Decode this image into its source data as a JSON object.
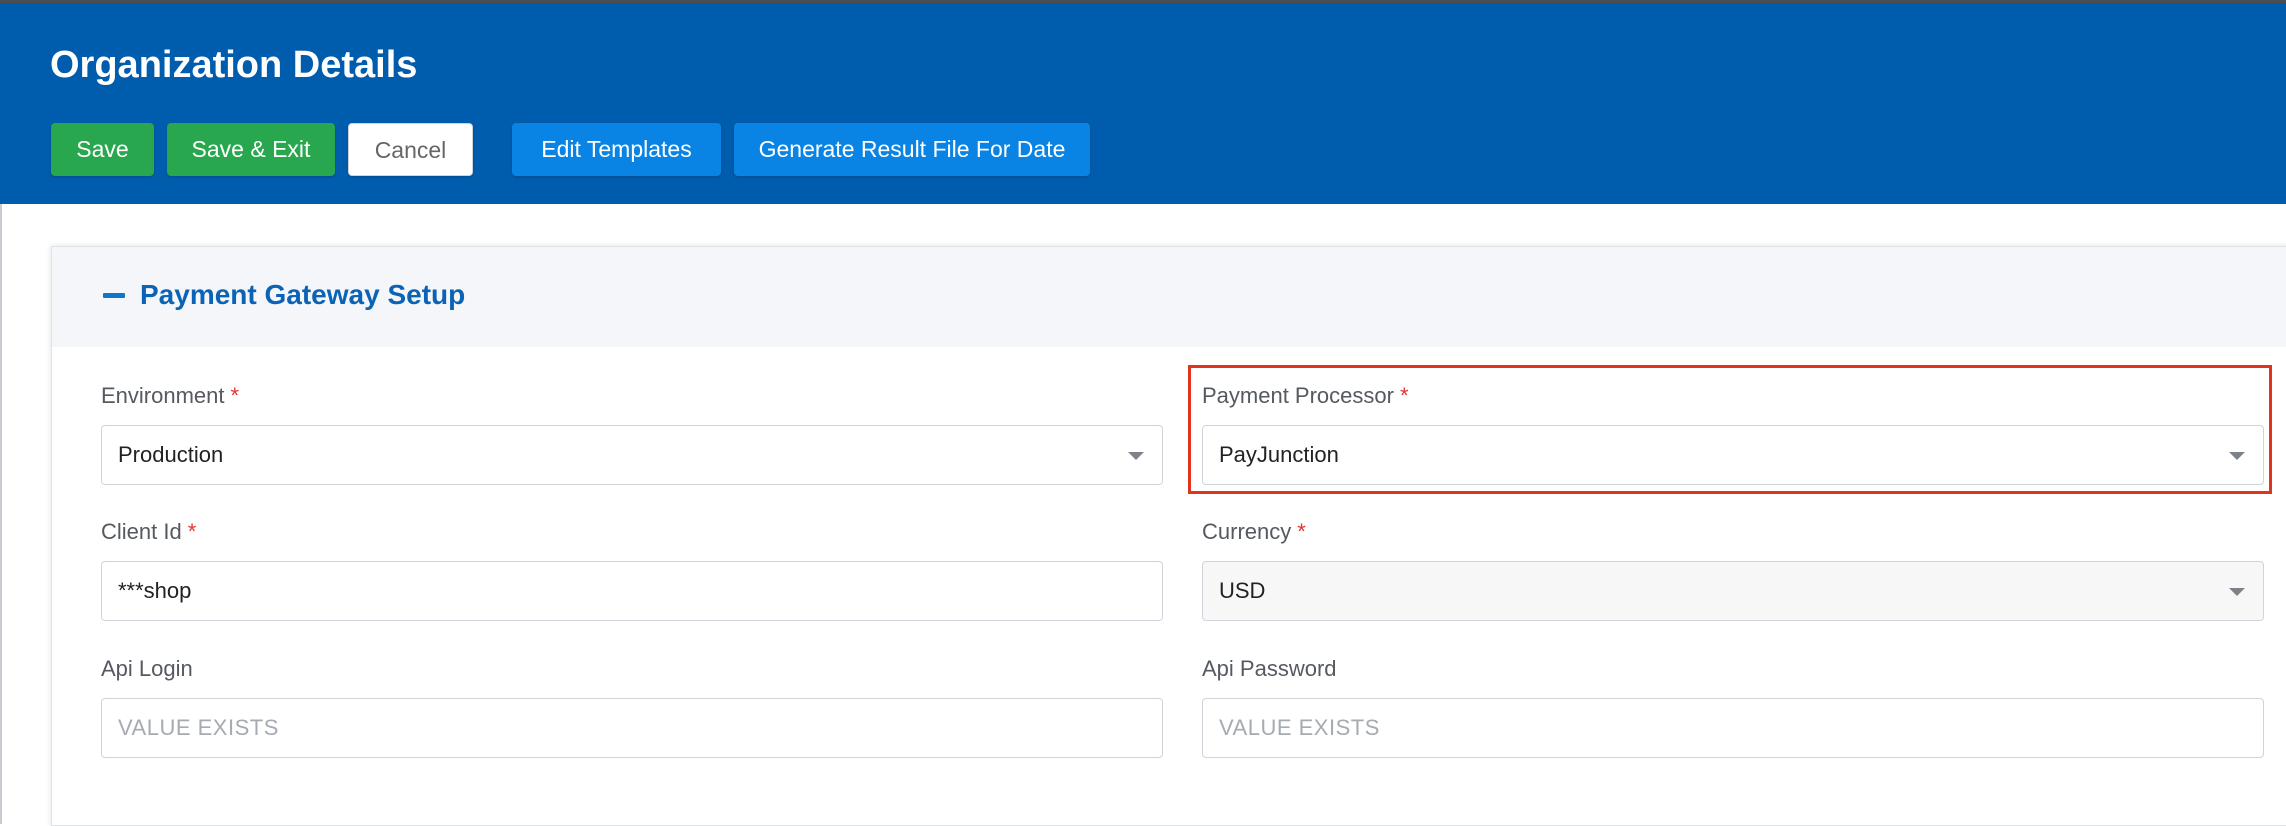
{
  "header": {
    "title": "Organization Details",
    "buttons": {
      "save": "Save",
      "save_exit": "Save & Exit",
      "cancel": "Cancel",
      "edit_templates": "Edit Templates",
      "generate_result": "Generate Result File For Date"
    }
  },
  "section": {
    "title": "Payment Gateway Setup",
    "collapse_icon": "minus-icon"
  },
  "fields": {
    "environment": {
      "label": "Environment",
      "required": "*",
      "value": "Production"
    },
    "payment_processor": {
      "label": "Payment Processor",
      "required": "*",
      "value": "PayJunction"
    },
    "client_id": {
      "label": "Client Id",
      "required": "*",
      "value": "***shop"
    },
    "currency": {
      "label": "Currency",
      "required": "*",
      "value": "USD"
    },
    "api_login": {
      "label": "Api Login",
      "placeholder": "VALUE EXISTS"
    },
    "api_password": {
      "label": "Api Password",
      "placeholder": "VALUE EXISTS"
    }
  },
  "colors": {
    "header_bg": "#005cad",
    "save_green": "#28a74e",
    "action_blue": "#0a84e4",
    "highlight_red": "#e0341c",
    "required_red": "#e3342f"
  }
}
